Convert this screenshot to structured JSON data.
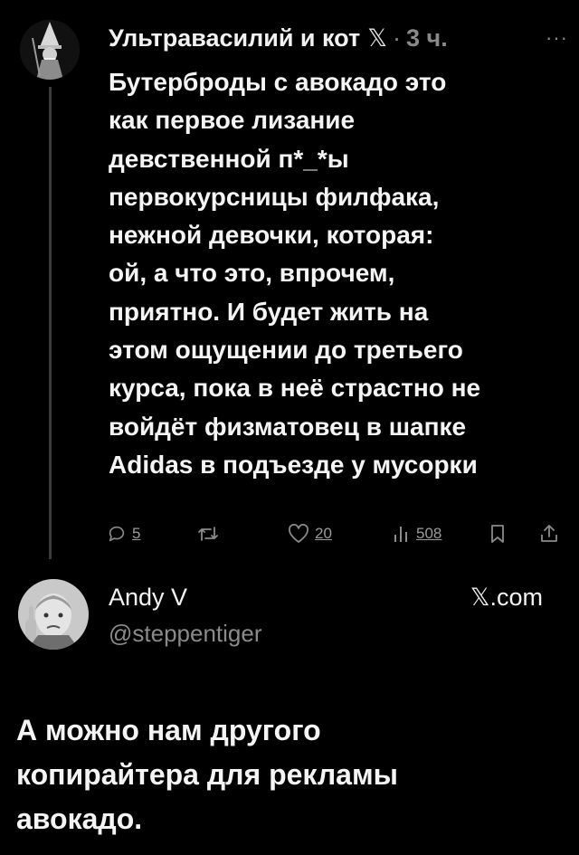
{
  "post": {
    "author_name": "Ультравасилий и кот",
    "x_mark": "𝕏",
    "separator": "·",
    "time": "3 ч.",
    "more": "···",
    "text_lines": [
      "Бутерброды с авокадо это",
      "как первое лизание",
      "девственной п*_*ы",
      "первокурсницы филфака,",
      "нежной девочки, которая:",
      "ой, а что это, впрочем,",
      "приятно. И будет жить на",
      "этом ощущении до третьего",
      "курса, пока в неё страстно не",
      "войдёт физматовец в шапке",
      "Adidas в подъезде у мусорки"
    ],
    "actions": {
      "replies": "5",
      "likes": "20",
      "views": "508"
    }
  },
  "repost": {
    "author_name": "Andy V",
    "handle": "@steppentiger",
    "source": "𝕏.com",
    "caption_lines": [
      "А можно нам другого",
      "копирайтера для рекламы",
      "авокадо."
    ]
  },
  "icons": {
    "reply": "reply-icon",
    "retweet": "retweet-icon",
    "like": "heart-icon",
    "views": "views-icon",
    "bookmark": "bookmark-icon",
    "share": "share-icon"
  }
}
